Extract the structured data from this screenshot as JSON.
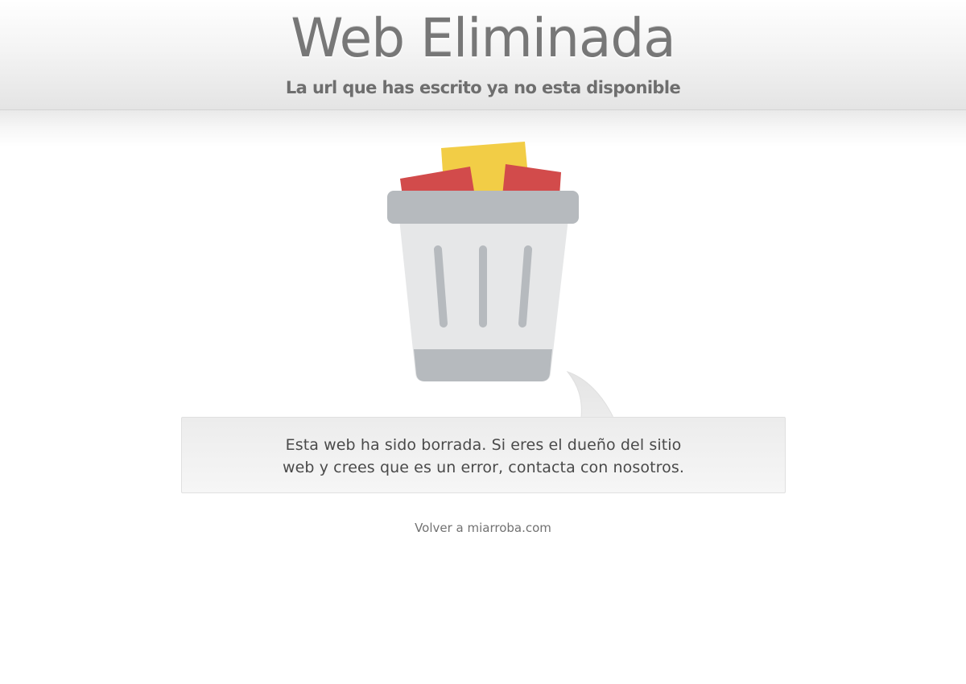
{
  "header": {
    "title": "Web Eliminada",
    "subtitle": "La url que has escrito ya no esta disponible"
  },
  "illustration": {
    "icon": "trash-bin-icon",
    "colors": {
      "bin_light": "#e6e7e8",
      "bin_gray": "#b6babe",
      "paper_yellow": "#f2cd46",
      "paper_red": "#d24b4b"
    }
  },
  "message": {
    "line1": "Esta web ha sido borrada. Si eres el dueño del sitio",
    "line2": "web y crees que es un error, contacta con nosotros."
  },
  "footer": {
    "back_link": "Volver a miarroba.com"
  }
}
